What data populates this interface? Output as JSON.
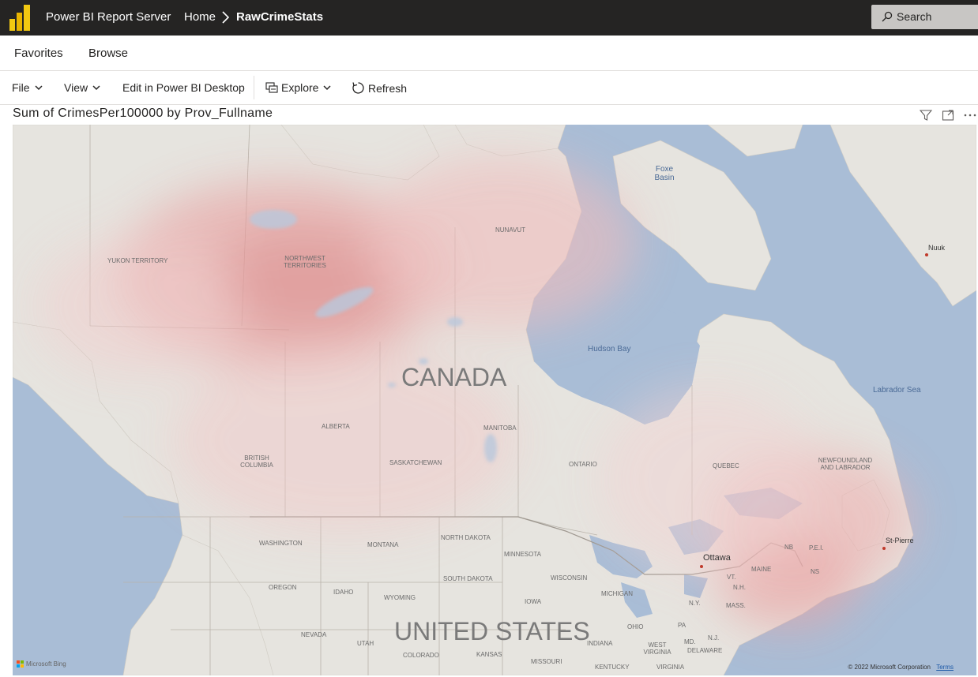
{
  "header": {
    "app_name": "Power BI Report Server",
    "breadcrumb": {
      "home": "Home",
      "current": "RawCrimeStats"
    },
    "search_label": "Search"
  },
  "nav": {
    "favorites": "Favorites",
    "browse": "Browse"
  },
  "toolbar": {
    "file": "File",
    "view": "View",
    "edit": "Edit in Power BI Desktop",
    "explore": "Explore",
    "refresh": "Refresh"
  },
  "visual": {
    "title": "Sum of CrimesPer100000 by Prov_Fullname",
    "icons": [
      "filter-icon",
      "focus-mode-icon",
      "more-options-icon"
    ]
  },
  "map": {
    "regions": {
      "yukon": "YUKON TERRITORY",
      "nwt": "NORTHWEST TERRITORIES",
      "nunavut": "NUNAVUT",
      "alberta": "ALBERTA",
      "manitoba": "MANITOBA",
      "saskatchewan": "SASKATCHEWAN",
      "bc": "BRITISH COLUMBIA",
      "ontario": "ONTARIO",
      "quebec": "QUEBEC",
      "nl": "NEWFOUNDLAND AND LABRADOR",
      "nb": "NB",
      "pei": "P.E.I.",
      "ns": "NS",
      "washington": "WASHINGTON",
      "montana": "MONTANA",
      "north_dakota": "NORTH DAKOTA",
      "minnesota": "MINNESOTA",
      "oregon": "OREGON",
      "idaho": "IDAHO",
      "wyoming": "WYOMING",
      "south_dakota": "SOUTH DAKOTA",
      "wisconsin": "WISCONSIN",
      "michigan": "MICHIGAN",
      "iowa": "IOWA",
      "nevada": "NEVADA",
      "utah": "UTAH",
      "colorado": "COLORADO",
      "kansas": "KANSAS",
      "missouri": "MISSOURI",
      "ohio": "OHIO",
      "indiana": "INDIANA",
      "pa": "PA",
      "ny": "N.Y.",
      "maine": "MAINE",
      "vt": "VT.",
      "nh": "N.H.",
      "mass": "MASS.",
      "md": "MD.",
      "nj": "N.J.",
      "delaware": "DELAWARE",
      "west_virginia": "WEST VIRGINIA",
      "kentucky": "KENTUCKY",
      "virginia": "VIRGINIA"
    },
    "water": {
      "foxe_basin": "Foxe Basin",
      "hudson_bay": "Hudson Bay",
      "labrador_sea": "Labrador Sea"
    },
    "countries": {
      "canada": "CANADA",
      "usa": "UNITED STATES"
    },
    "cities": {
      "ottawa": "Ottawa",
      "nuuk": "Nuuk",
      "st_pierre": "St-Pierre"
    },
    "attribution": {
      "bing": "Microsoft Bing",
      "copyright": "© 2022 Microsoft Corporation",
      "terms": "Terms"
    }
  }
}
